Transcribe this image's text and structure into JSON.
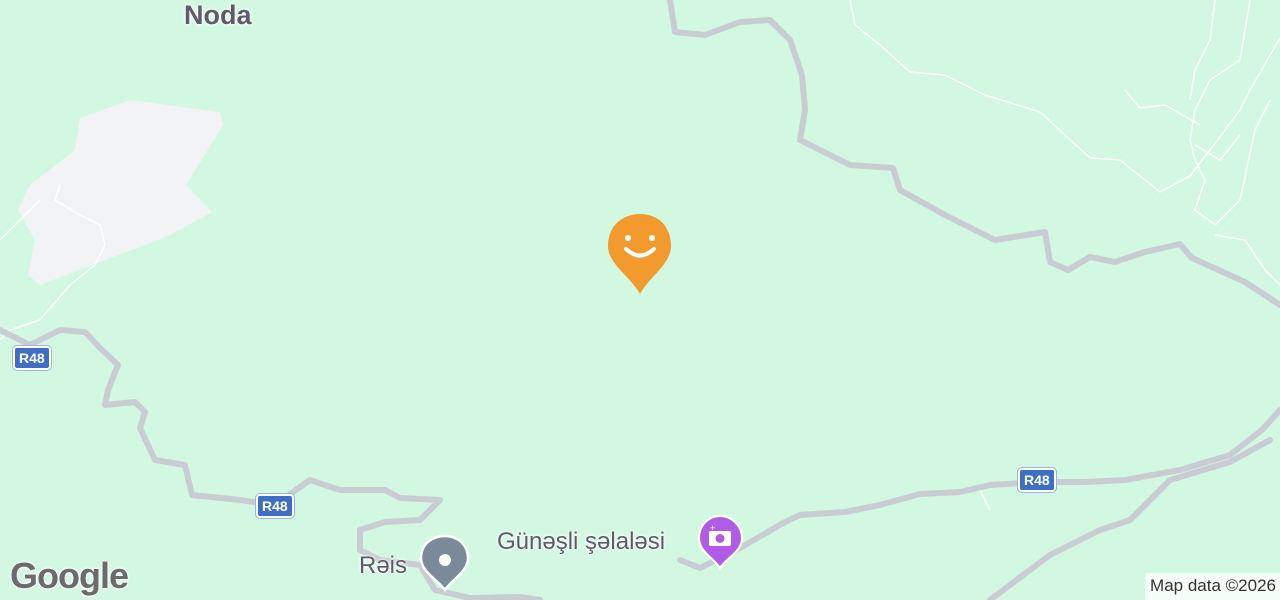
{
  "map": {
    "colors": {
      "land": "#d3f8e2",
      "road": "#c9cdd3",
      "path": "#ffffff",
      "urban": "#f2f3f4",
      "shield": "#3f6fc4",
      "user_pin": "#f39a2e",
      "photo_poi": "#b05ce6",
      "place_poi": "#7b8a99"
    },
    "labels": {
      "town_noda": "Noda",
      "village_reis": "Rəis",
      "waterfall": "Günəşli şəlaləsi"
    },
    "route_shields": [
      "R48",
      "R48",
      "R48"
    ],
    "icons": {
      "user_pin": "smiley-location-pin-icon",
      "photo_poi": "camera-pin-icon",
      "place_poi": "location-pin-icon"
    },
    "branding": "Google",
    "attribution": "Map data ©2026"
  }
}
